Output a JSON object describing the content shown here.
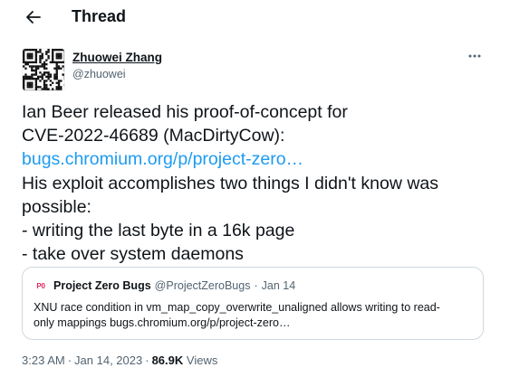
{
  "header": {
    "title": "Thread",
    "back_icon": "arrow-left-icon"
  },
  "tweet": {
    "author": {
      "name": "Zhuowei Zhang",
      "handle": "@zhuowei",
      "avatar_icon": "qr-code-avatar"
    },
    "more_icon": "more-horizontal-icon",
    "lines": [
      "Ian Beer released his proof-of-concept for",
      "CVE-2022-46689 (MacDirtyCow):",
      "bugs.chromium.org/p/project-zero…",
      "His exploit accomplishes two things I didn't know was",
      "possible:",
      "- writing the last byte in a 16k page",
      "- take over system daemons"
    ],
    "quote": {
      "avatar_text": "P0",
      "name": "Project Zero Bugs",
      "handle": "@ProjectZeroBugs",
      "separator": "·",
      "date": "Jan 14",
      "lines": [
        "XNU race condition in vm_map_copy_overwrite_unaligned allows writing to read-",
        "only mappings bugs.chromium.org/p/project-zero…"
      ]
    },
    "meta": {
      "time": "3:23 AM",
      "separator": "·",
      "date": "Jan 14, 2023",
      "views_count": "86.9K",
      "views_label": "Views"
    }
  },
  "colors": {
    "text": "#0f1419",
    "secondary": "#536471",
    "link": "#1d9bf0",
    "border": "#cfd9de",
    "p0_accent": "#e0245e"
  }
}
